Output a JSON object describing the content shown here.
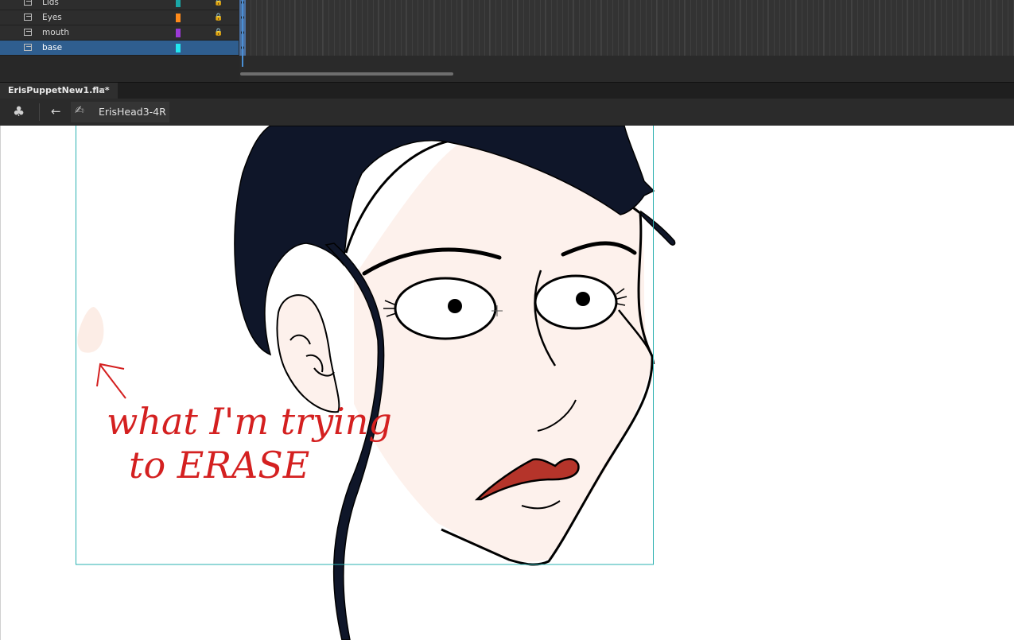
{
  "timeline": {
    "layers": [
      {
        "name": "Lids",
        "color": "#1aa6a6",
        "locked": true,
        "selected": false
      },
      {
        "name": "Eyes",
        "color": "#ff8a1a",
        "locked": true,
        "selected": false
      },
      {
        "name": "mouth",
        "color": "#9b3ad6",
        "locked": true,
        "selected": false
      },
      {
        "name": "base",
        "color": "#22e6f0",
        "locked": false,
        "selected": true
      }
    ],
    "lock_glyph": "🔒"
  },
  "document_tab": {
    "title": "ErisPuppetNew1.fla*",
    "close_glyph": "×"
  },
  "edit_bar": {
    "scene_glyph": "♣",
    "back_glyph": "←",
    "symbol_glyph": "✍",
    "symbol_name": "ErisHead3-4R"
  },
  "stage": {
    "annotation_line1": "what I'm trying",
    "annotation_line2": "to ERASE",
    "annotation_color": "#d42020",
    "hair_color": "#0f1629",
    "skin_color": "#fdf1ec",
    "lip_color": "#b5342a",
    "bounding_box_color": "#2ab0b0"
  }
}
